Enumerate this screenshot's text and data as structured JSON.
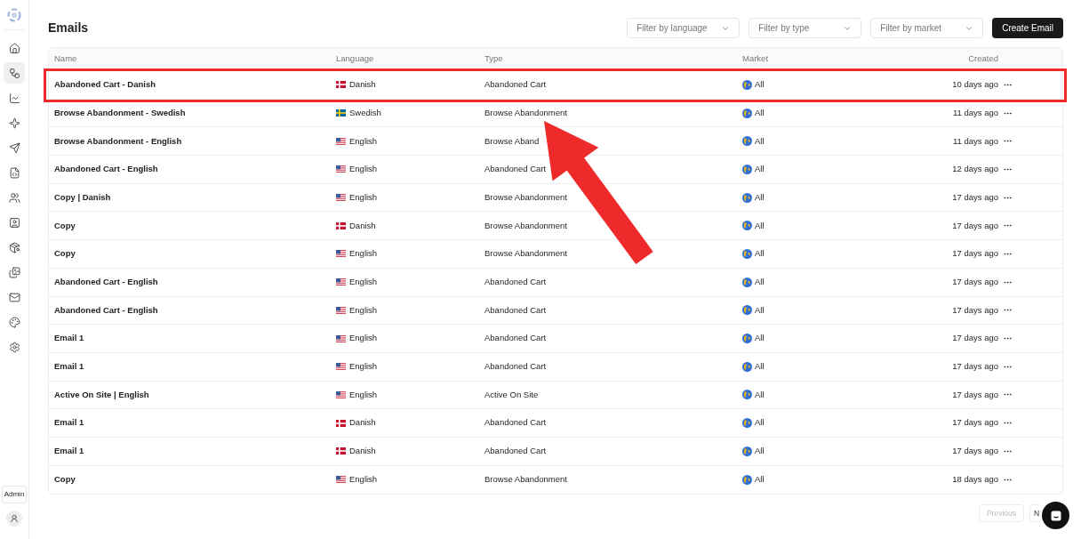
{
  "sidebar": {
    "items": [
      {
        "selected": false
      },
      {
        "selected": true
      },
      {
        "selected": false
      },
      {
        "selected": false
      },
      {
        "selected": false
      },
      {
        "selected": false
      },
      {
        "selected": false
      },
      {
        "selected": false
      },
      {
        "selected": false
      },
      {
        "selected": false
      },
      {
        "selected": false
      },
      {
        "selected": false
      },
      {
        "selected": false
      }
    ],
    "role_badge": "Admin"
  },
  "page": {
    "title": "Emails",
    "filters": [
      {
        "placeholder": "Filter by language"
      },
      {
        "placeholder": "Filter by type"
      },
      {
        "placeholder": "Filter by market"
      }
    ],
    "create_button": "Create Email"
  },
  "table": {
    "columns": [
      "Name",
      "Language",
      "Type",
      "Market",
      "Created"
    ],
    "rows": [
      {
        "name": "Abandoned Cart - Danish",
        "kind": "dk",
        "language": "Danish",
        "type": "Abandoned Cart",
        "market": "All",
        "created": "10 days ago",
        "highlighted": true
      },
      {
        "name": "Browse Abandonment - Swedish",
        "kind": "se",
        "language": "Swedish",
        "type": "Browse Abandonment",
        "market": "All",
        "created": "11 days ago",
        "highlighted": false
      },
      {
        "name": "Browse Abandonment - English",
        "kind": "us",
        "language": "English",
        "type": "Browse Aband",
        "market": "All",
        "created": "11 days ago",
        "highlighted": false
      },
      {
        "name": "Abandoned Cart - English",
        "kind": "us",
        "language": "English",
        "type": "Abandoned Cart",
        "market": "All",
        "created": "12 days ago",
        "highlighted": false
      },
      {
        "name": "Copy | Danish",
        "kind": "us",
        "language": "English",
        "type": "Browse Abandonment",
        "market": "All",
        "created": "17 days ago",
        "highlighted": false
      },
      {
        "name": "Copy",
        "kind": "dk",
        "language": "Danish",
        "type": "Browse Abandonment",
        "market": "All",
        "created": "17 days ago",
        "highlighted": false
      },
      {
        "name": "Copy",
        "kind": "us",
        "language": "English",
        "type": "Browse Abandonment",
        "market": "All",
        "created": "17 days ago",
        "highlighted": false
      },
      {
        "name": "Abandoned Cart - English",
        "kind": "us",
        "language": "English",
        "type": "Abandoned Cart",
        "market": "All",
        "created": "17 days ago",
        "highlighted": false
      },
      {
        "name": "Abandoned Cart - English",
        "kind": "us",
        "language": "English",
        "type": "Abandoned Cart",
        "market": "All",
        "created": "17 days ago",
        "highlighted": false
      },
      {
        "name": "Email 1",
        "kind": "us",
        "language": "English",
        "type": "Abandoned Cart",
        "market": "All",
        "created": "17 days ago",
        "highlighted": false
      },
      {
        "name": "Email 1",
        "kind": "us",
        "language": "English",
        "type": "Abandoned Cart",
        "market": "All",
        "created": "17 days ago",
        "highlighted": false
      },
      {
        "name": "Active On Site | English",
        "kind": "us",
        "language": "English",
        "type": "Active On Site",
        "market": "All",
        "created": "17 days ago",
        "highlighted": false
      },
      {
        "name": "Email 1",
        "kind": "dk",
        "language": "Danish",
        "type": "Abandoned Cart",
        "market": "All",
        "created": "17 days ago",
        "highlighted": false
      },
      {
        "name": "Email 1",
        "kind": "dk",
        "language": "Danish",
        "type": "Abandoned Cart",
        "market": "All",
        "created": "17 days ago",
        "highlighted": false
      },
      {
        "name": "Copy",
        "kind": "us",
        "language": "English",
        "type": "Browse Abandonment",
        "market": "All",
        "created": "18 days ago",
        "highlighted": false
      }
    ]
  },
  "pagination": {
    "previous": {
      "label": "Previous",
      "disabled": true
    },
    "next": {
      "label": "N",
      "disabled": false
    }
  }
}
